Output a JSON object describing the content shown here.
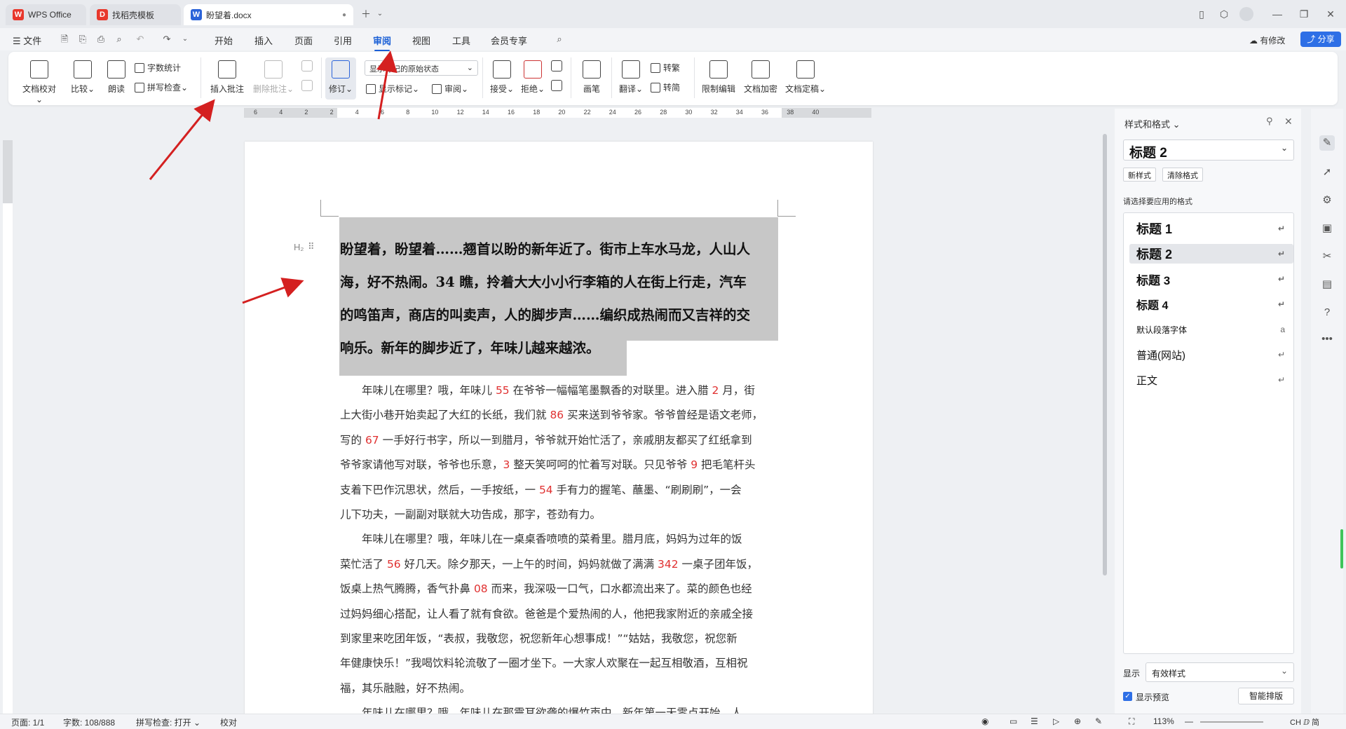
{
  "tabs": [
    {
      "label": "WPS Office",
      "color": "#e8372c",
      "glyph": "W"
    },
    {
      "label": "找稻壳模板",
      "color": "#e8372c",
      "glyph": "D"
    },
    {
      "label": "盼望着.docx",
      "color": "#2b63d9",
      "glyph": "W"
    }
  ],
  "menu": {
    "file": "文件",
    "items": [
      "开始",
      "插入",
      "页面",
      "引用",
      "审阅",
      "视图",
      "工具",
      "会员专享"
    ],
    "active": "审阅",
    "modified": "有修改",
    "share": "分享"
  },
  "ribbon": {
    "proofread": "文档校对",
    "compare": "比较",
    "read_aloud": "朗读",
    "word_count": "字数统计",
    "spell_check": "拼写检查",
    "insert_comment": "插入批注",
    "delete_comment": "删除批注",
    "revise": "修订",
    "show_state": "显示标记的原始状态",
    "show_marks": "显示标记",
    "review": "审阅",
    "accept": "接受",
    "reject": "拒绝",
    "ink": "画笔",
    "translate": "翻译",
    "trad": "转繁",
    "simp": "转简",
    "restrict": "限制编辑",
    "encrypt": "文档加密",
    "finalize": "文档定稿"
  },
  "ruler_numbers": [
    "6",
    "4",
    "2",
    "2",
    "4",
    "6",
    "8",
    "10",
    "12",
    "14",
    "16",
    "18",
    "20",
    "22",
    "24",
    "26",
    "28",
    "30",
    "32",
    "34",
    "36",
    "38",
    "40"
  ],
  "document": {
    "heading_lines": [
      "盼望着，盼望着……翘首以盼的新年近了。街市上车水马龙，人山人",
      "海，好不热闹。34 瞧，拎着大大小小行李箱的人在街上行走，汽车",
      "的鸣笛声，商店的叫卖声，人的脚步声……编织成热闹而又吉祥的交",
      "响乐。新年的脚步近了，年味儿越来越浓。"
    ],
    "body_lines": [
      [
        {
          "t": "　　年味儿在哪里？哦，年味儿 "
        },
        {
          "t": "55",
          "r": true
        },
        {
          "t": " 在爷爷一幅幅笔墨飘香的对联里。进入腊 "
        },
        {
          "t": "2",
          "r": true
        },
        {
          "t": " 月，街"
        }
      ],
      [
        {
          "t": "上大街小巷开始卖起了大红的长纸，我们就 "
        },
        {
          "t": "86",
          "r": true
        },
        {
          "t": " 买来送到爷爷家。爷爷曾经是语文老师，"
        }
      ],
      [
        {
          "t": "写的 "
        },
        {
          "t": "67",
          "r": true
        },
        {
          "t": " 一手好行书字，所以一到腊月，爷爷就开始忙活了，亲戚朋友都买了红纸拿到"
        }
      ],
      [
        {
          "t": "爷爷家请他写对联，爷爷也乐意，"
        },
        {
          "t": "3",
          "r": true
        },
        {
          "t": " 整天笑呵呵的忙着写对联。只见爷爷 "
        },
        {
          "t": "9",
          "r": true
        },
        {
          "t": " 把毛笔杆头"
        }
      ],
      [
        {
          "t": "支着下巴作沉思状，然后，一手按纸，一 "
        },
        {
          "t": "54",
          "r": true
        },
        {
          "t": " 手有力的握笔、蘸墨、“刷刷刷”，一会"
        }
      ],
      [
        {
          "t": "儿下功夫，一副副对联就大功告成，那字，苍劲有力。"
        }
      ],
      [
        {
          "t": "　　年味儿在哪里？哦，年味儿在一桌桌香喷喷的菜肴里。腊月底，妈妈为过年的饭"
        }
      ],
      [
        {
          "t": "菜忙活了 "
        },
        {
          "t": "56",
          "r": true
        },
        {
          "t": " 好几天。除夕那天，一上午的时间，妈妈就做了满满 "
        },
        {
          "t": "342",
          "r": true
        },
        {
          "t": " 一桌子团年饭，"
        }
      ],
      [
        {
          "t": "饭桌上热气腾腾，香气扑鼻 "
        },
        {
          "t": "08",
          "r": true
        },
        {
          "t": " 而来，我深吸一口气，口水都流出来了。菜的颜色也经"
        }
      ],
      [
        {
          "t": "过妈妈细心搭配，让人看了就有食欲。爸爸是个爱热闹的人，他把我家附近的亲戚全接"
        }
      ],
      [
        {
          "t": "到家里来吃团年饭，“表叔，我敬您，祝您新年心想事成！”“姑姑，我敬您，祝您新"
        }
      ],
      [
        {
          "t": "年健康快乐！”我喝饮料轮流敬了一圈才坐下。一大家人欢聚在一起互相敬酒，互相祝"
        }
      ],
      [
        {
          "t": "福，其乐融融，好不热闹。"
        }
      ],
      [
        {
          "t": "　　年味儿在哪里？哦，年味儿在那震耳欲聋的爆竹声中。新年第一天零点开始，人"
        }
      ]
    ],
    "heading_marker": "H₂"
  },
  "panel": {
    "title": "样式和格式",
    "current_style": "标题 2",
    "new_style": "新样式",
    "clear_format": "清除格式",
    "choose_label": "请选择要应用的格式",
    "styles": [
      "标题 1",
      "标题 2",
      "标题 3",
      "标题 4",
      "默认段落字体",
      "普通(网站)",
      "正文"
    ],
    "show_label": "显示",
    "show_value": "有效样式",
    "preview_label": "显示预览",
    "smart": "智能排版"
  },
  "status": {
    "page": "页面: 1/1",
    "words": "字数: 108/888",
    "spell": "拼写检查: 打开",
    "proof": "校对",
    "zoom": "113%",
    "ime": "CH ⅅ 简"
  },
  "colors": {
    "accent": "#1a5fd6",
    "arrow": "#d42020",
    "selection": "#c7c7c7"
  }
}
